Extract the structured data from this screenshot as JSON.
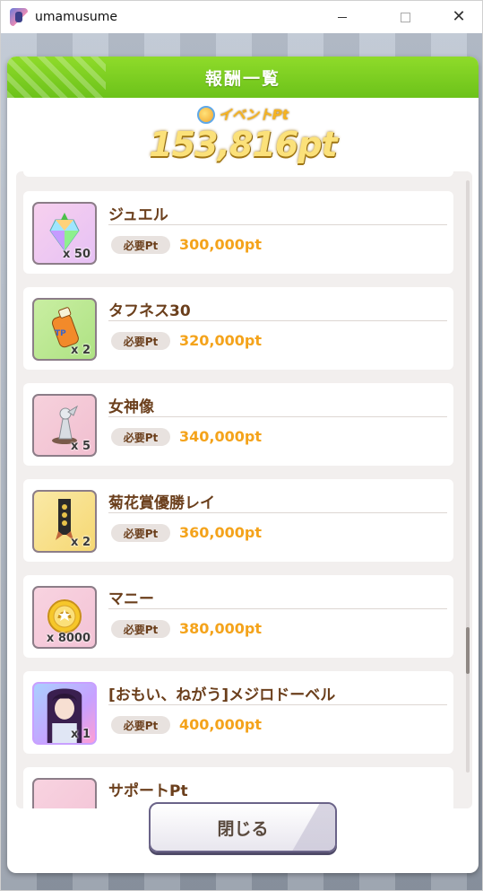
{
  "window": {
    "title": "umamusume"
  },
  "dialog": {
    "title": "報酬一覧",
    "event_label": "イベントPt",
    "total_points": "153,816pt",
    "required_label": "必要Pt",
    "close_label": "閉じる"
  },
  "rewards": [
    {
      "name": "ジュエル",
      "qty": "x 50",
      "required": "300,000pt"
    },
    {
      "name": "タフネス30",
      "qty": "x 2",
      "required": "320,000pt"
    },
    {
      "name": "女神像",
      "qty": "x 5",
      "required": "340,000pt"
    },
    {
      "name": "菊花賞優勝レイ",
      "qty": "x 2",
      "required": "360,000pt"
    },
    {
      "name": "マニー",
      "qty": "x 8000",
      "required": "380,000pt"
    },
    {
      "name": "[おもい、ねがう]メジロドーベル",
      "qty": "x 1",
      "required": "400,000pt"
    },
    {
      "name": "サポートPt",
      "qty": "",
      "required": ""
    }
  ],
  "colors": {
    "header_green": "#7ccf20",
    "value_orange": "#f4a31b",
    "name_brown": "#6b3f1c"
  },
  "icons": [
    "jewel-icon",
    "tp-bottle-icon",
    "goddess-statue-icon",
    "kikka-sho-rei-icon",
    "money-coin-icon",
    "ssr-card-icon"
  ]
}
